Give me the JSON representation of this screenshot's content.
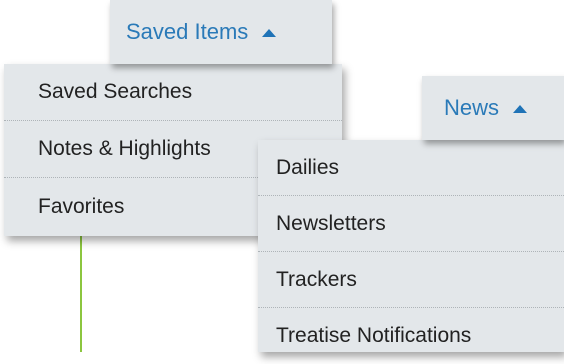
{
  "saved_items": {
    "label": "Saved Items",
    "items": [
      {
        "label": "Saved Searches"
      },
      {
        "label": "Notes & Highlights"
      },
      {
        "label": "Favorites"
      }
    ]
  },
  "news": {
    "label": "News",
    "items": [
      {
        "label": "Dailies"
      },
      {
        "label": "Newsletters"
      },
      {
        "label": "Trackers"
      },
      {
        "label": "Treatise Notifications"
      }
    ]
  },
  "colors": {
    "menu_background": "#e3e7ea",
    "tab_text": "#2a7ab8",
    "item_text": "#222222",
    "accent_line": "#8cc63f"
  },
  "icons": {
    "tab_caret": "caret-up-icon"
  }
}
